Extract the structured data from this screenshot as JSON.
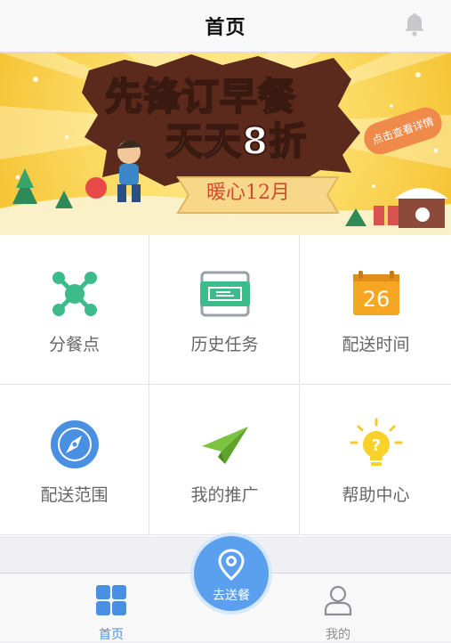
{
  "header": {
    "title": "首页"
  },
  "banner": {
    "headline_line1": "先锋订早餐",
    "headline_line2": "天天8折",
    "subtitle": "暖心12月",
    "badge": "点击查看详情"
  },
  "grid": {
    "items": [
      {
        "label": "分餐点",
        "icon": "molecule-icon"
      },
      {
        "label": "历史任务",
        "icon": "history-card-icon"
      },
      {
        "label": "配送时间",
        "icon": "calendar-icon"
      },
      {
        "label": "配送范围",
        "icon": "compass-icon"
      },
      {
        "label": "我的推广",
        "icon": "paper-plane-icon"
      },
      {
        "label": "帮助中心",
        "icon": "lightbulb-icon"
      }
    ]
  },
  "calendar_day": "26",
  "tabbar": {
    "home_label": "首页",
    "deliver_label": "去送餐",
    "mine_label": "我的"
  },
  "colors": {
    "accent": "#4a90e2",
    "green": "#3dbb8a",
    "orange": "#f5a623",
    "yellow": "#f8d12a"
  }
}
